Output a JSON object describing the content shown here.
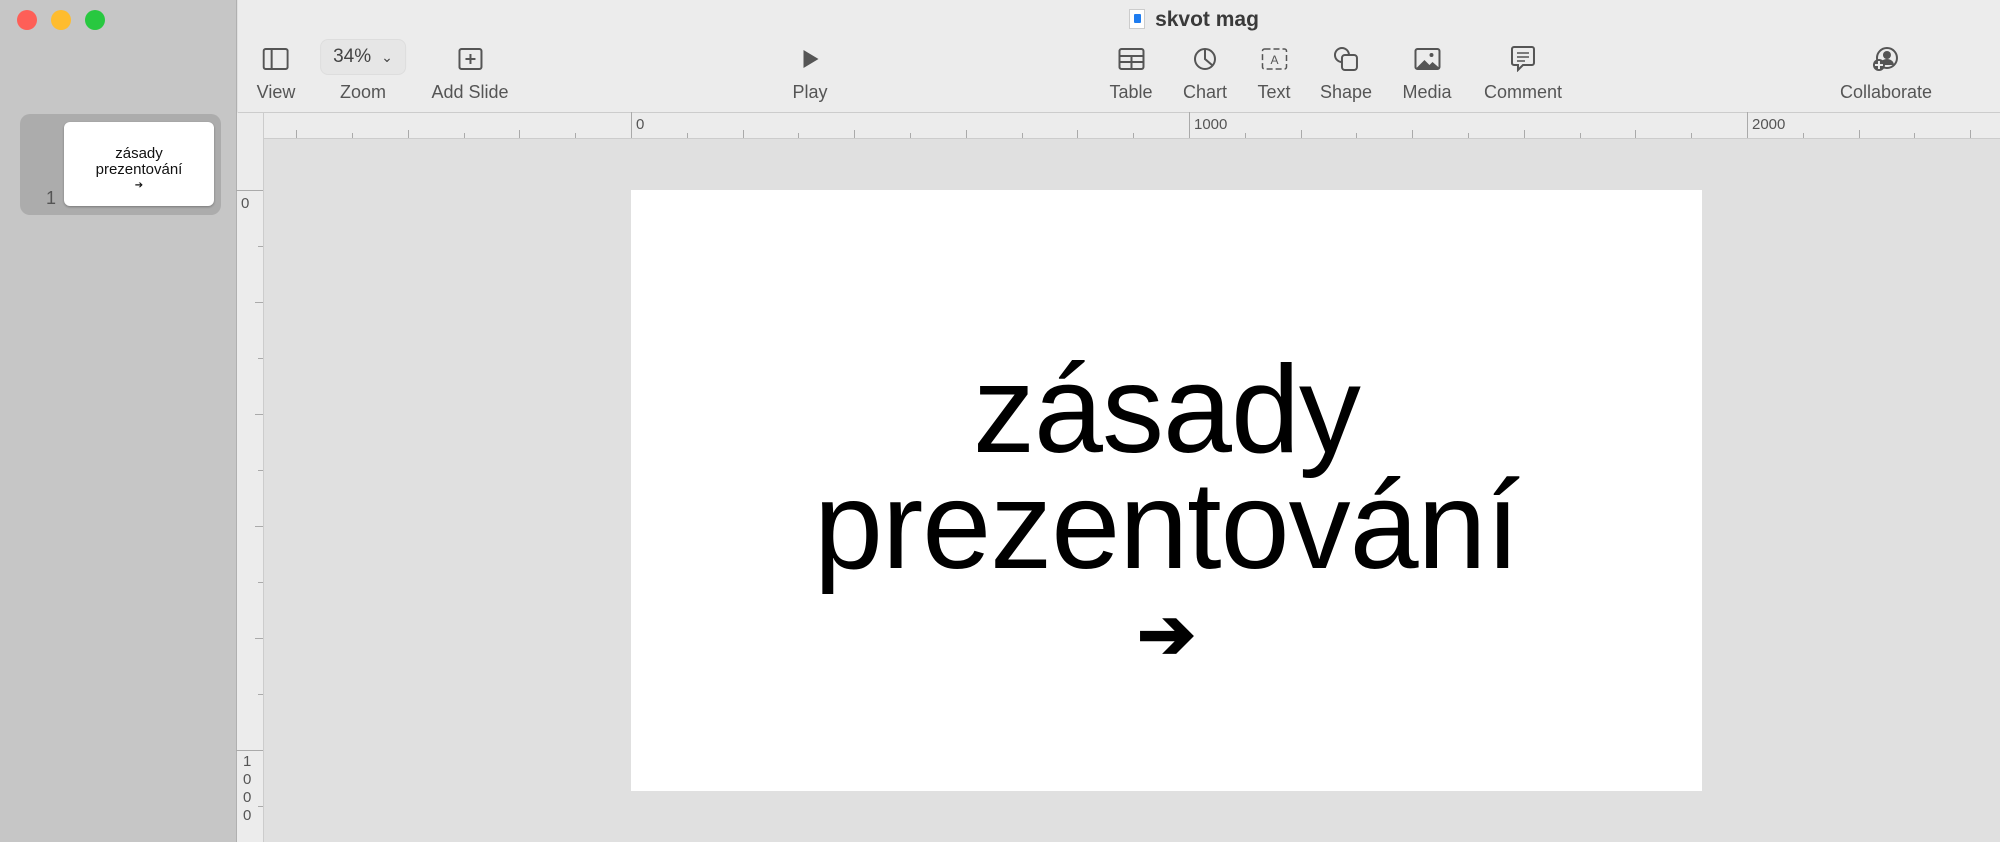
{
  "window": {
    "title": "skvot mag",
    "controls": {
      "close": "#fe5f57",
      "minimize": "#febc2e",
      "maximize": "#28c840"
    }
  },
  "toolbar": {
    "view": "View",
    "zoom": "Zoom",
    "zoom_value": "34%",
    "add_slide": "Add Slide",
    "play": "Play",
    "table": "Table",
    "chart": "Chart",
    "text": "Text",
    "shape": "Shape",
    "media": "Media",
    "comment": "Comment",
    "collaborate": "Collaborate"
  },
  "navigator": {
    "slides": [
      {
        "number": "1",
        "line1": "zásady",
        "line2": "prezentování",
        "arrow": "➔"
      }
    ]
  },
  "rulers": {
    "horizontal": [
      "0",
      "1000",
      "2000"
    ],
    "vertical": [
      "0",
      "1000"
    ]
  },
  "slide": {
    "line1": "zásady",
    "line2": "prezentování",
    "arrow": "➔"
  }
}
